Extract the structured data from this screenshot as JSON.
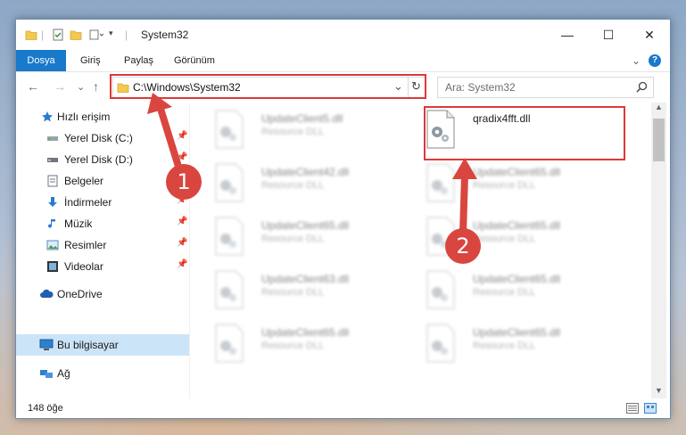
{
  "window": {
    "title": "System32",
    "min_label": "—",
    "max_label": "☐",
    "close_label": "✕"
  },
  "ribbon": {
    "tabs": [
      "Dosya",
      "Giriş",
      "Paylaş",
      "Görünüm"
    ],
    "collapse_label": "⌄",
    "help_label": "?"
  },
  "address": {
    "path": "C:\\Windows\\System32",
    "dropdown_label": "⌄",
    "refresh_label": "↻"
  },
  "search": {
    "placeholder": "Ara: System32",
    "icon": "search-icon"
  },
  "nav": {
    "back": "←",
    "forward": "→",
    "recent": "⌄",
    "up": "↑"
  },
  "sidebar": {
    "items": [
      {
        "label": "Hızlı erişim",
        "icon": "star-icon",
        "pinned": false
      },
      {
        "label": "Yerel Disk (C:)",
        "icon": "drive-icon",
        "pinned": true
      },
      {
        "label": "Yerel Disk (D:)",
        "icon": "drive-icon",
        "pinned": true
      },
      {
        "label": "Belgeler",
        "icon": "document-icon",
        "pinned": true
      },
      {
        "label": "İndirmeler",
        "icon": "download-icon",
        "pinned": true
      },
      {
        "label": "Müzik",
        "icon": "music-icon",
        "pinned": true
      },
      {
        "label": "Resimler",
        "icon": "pictures-icon",
        "pinned": true
      },
      {
        "label": "Videolar",
        "icon": "video-icon",
        "pinned": true
      },
      {
        "label": "OneDrive",
        "icon": "cloud-icon",
        "pinned": false
      },
      {
        "label": "Bu bilgisayar",
        "icon": "computer-icon",
        "pinned": false,
        "selected": true
      },
      {
        "label": "Ağ",
        "icon": "network-icon",
        "pinned": false
      }
    ],
    "pin_glyph": "📌"
  },
  "files": [
    {
      "name": "UpdateClient5.dll",
      "type": "Resource DLL",
      "blurred": true
    },
    {
      "name": "qradix4fft.dll",
      "type": "",
      "blurred": false
    },
    {
      "name": "UpdateClient42.dll",
      "type": "Resource DLL",
      "blurred": true
    },
    {
      "name": "UpdateClient65.dll",
      "type": "Resource DLL",
      "blurred": true
    },
    {
      "name": "UpdateClient65.dll",
      "type": "Resource DLL",
      "blurred": true
    },
    {
      "name": "UpdateClient65.dll",
      "type": "Resource DLL",
      "blurred": true
    },
    {
      "name": "UpdateClient63.dll",
      "type": "Resource DLL",
      "blurred": true
    },
    {
      "name": "UpdateClient65.dll",
      "type": "Resource DLL",
      "blurred": true
    },
    {
      "name": "UpdateClient65.dll",
      "type": "Resource DLL",
      "blurred": true
    },
    {
      "name": "UpdateClient65.dll",
      "type": "Resource DLL",
      "blurred": true
    }
  ],
  "status": {
    "count": "148 öğe"
  },
  "annotations": {
    "step1": "1",
    "step2": "2",
    "color": "#d93a3a"
  }
}
